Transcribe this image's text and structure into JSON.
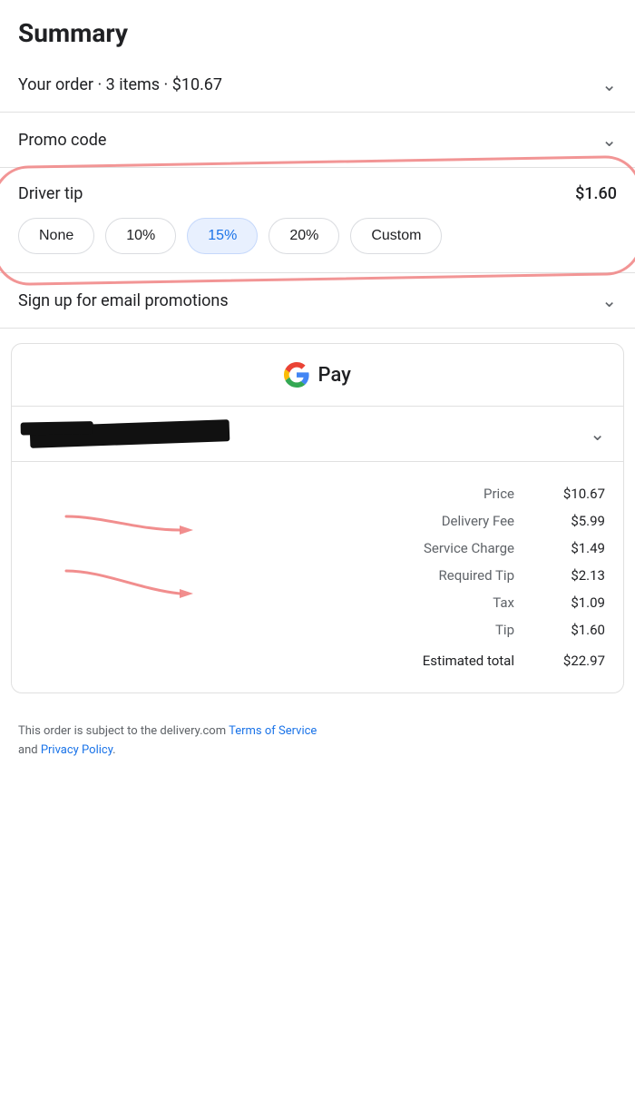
{
  "page": {
    "title": "Summary",
    "order_summary": {
      "label": "Your order · 3 items · $10.67"
    },
    "promo_code": {
      "label": "Promo code"
    },
    "driver_tip": {
      "label": "Driver tip",
      "amount": "$1.60",
      "options": [
        {
          "id": "none",
          "label": "None",
          "active": false
        },
        {
          "id": "10pct",
          "label": "10%",
          "active": false
        },
        {
          "id": "15pct",
          "label": "15%",
          "active": true
        },
        {
          "id": "20pct",
          "label": "20%",
          "active": false
        },
        {
          "id": "custom",
          "label": "Custom",
          "active": false
        }
      ]
    },
    "email_promotions": {
      "label": "Sign up for email promotions"
    },
    "gpay": {
      "logo_g": "G",
      "logo_text": "Pay"
    },
    "price_breakdown": {
      "rows": [
        {
          "label": "Price",
          "value": "$10.67"
        },
        {
          "label": "Delivery Fee",
          "value": "$5.99"
        },
        {
          "label": "Service Charge",
          "value": "$1.49"
        },
        {
          "label": "Required Tip",
          "value": "$2.13"
        },
        {
          "label": "Tax",
          "value": "$1.09"
        },
        {
          "label": "Tip",
          "value": "$1.60"
        },
        {
          "label": "Estimated total",
          "value": "$22.97"
        }
      ]
    },
    "terms": {
      "text1": "This order is subject to the delivery.com ",
      "link1": "Terms of Service",
      "text2": "\nand ",
      "link2": "Privacy Policy",
      "text3": "."
    }
  }
}
